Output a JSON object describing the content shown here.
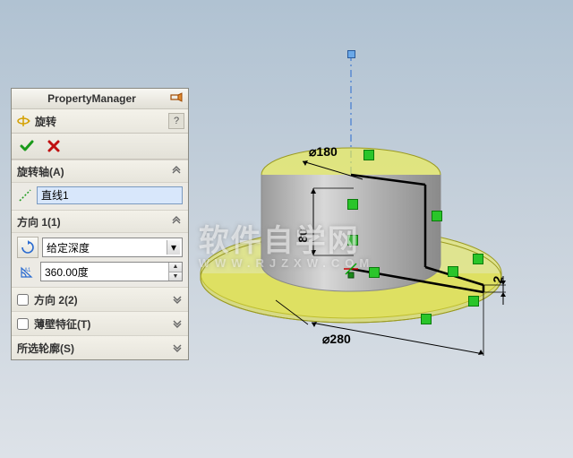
{
  "pm": {
    "title": "PropertyManager",
    "feature_label": "旋转",
    "sections": {
      "axis": {
        "header": "旋转轴(A)",
        "value": "直线1"
      },
      "dir1": {
        "header": "方向 1(1)",
        "end_condition": "给定深度",
        "angle": "360.00度"
      },
      "dir2": {
        "label": "方向 2(2)"
      },
      "thin": {
        "label": "薄壁特征(T)"
      },
      "contours": {
        "label": "所选轮廓(S)"
      }
    }
  },
  "dims": {
    "d_top": "⌀180",
    "d_bottom": "⌀280",
    "height": "80",
    "thick": "2"
  },
  "watermark": {
    "main": "软件自学网",
    "sub": "WWW.RJZXW.COM"
  }
}
